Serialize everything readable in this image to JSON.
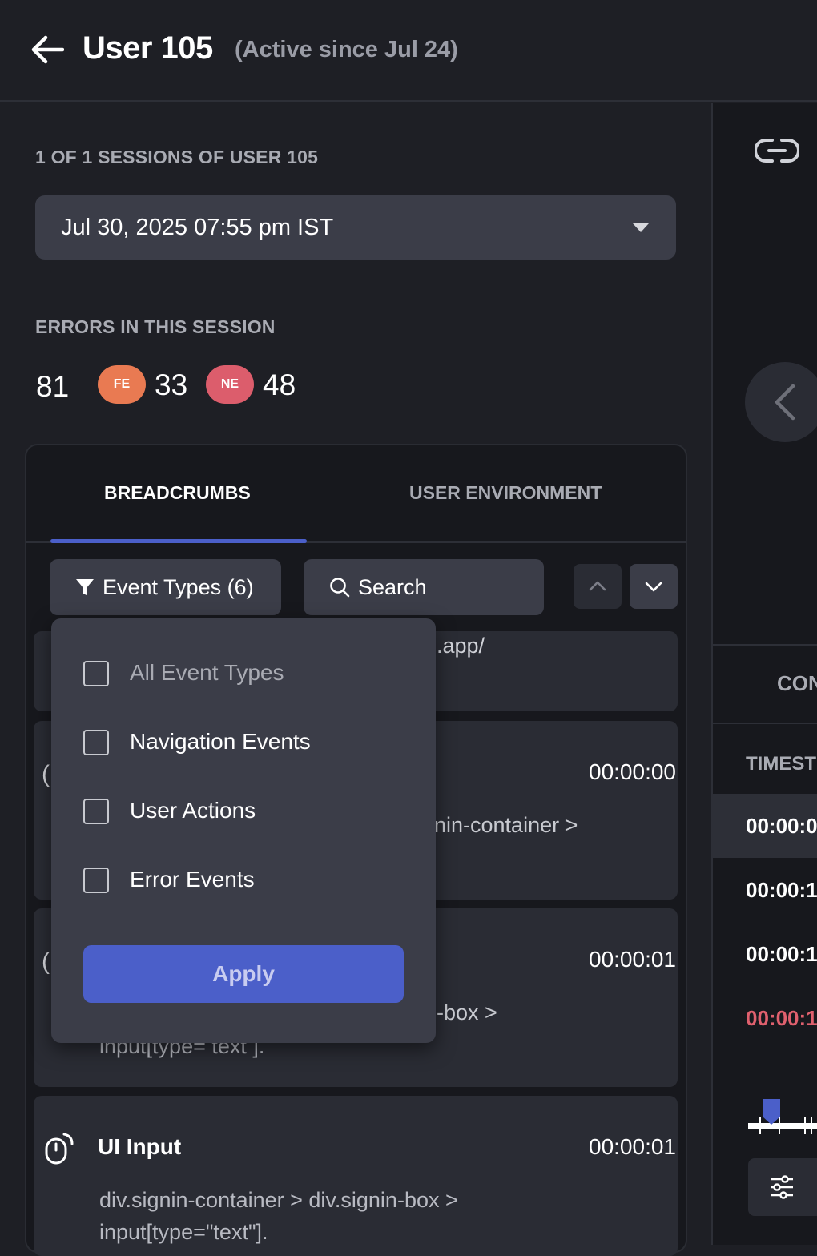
{
  "header": {
    "title": "User 105",
    "subtitle": "(Active since Jul 24)"
  },
  "sessions": {
    "label": "1 OF 1 SESSIONS OF USER 105",
    "selected": "Jul 30, 2025 07:55 pm IST"
  },
  "errors": {
    "label": "ERRORS IN THIS SESSION",
    "total": "81",
    "fe_badge": "FE",
    "fe_count": "33",
    "ne_badge": "NE",
    "ne_count": "48",
    "colors": {
      "fe": "#e97a52",
      "ne": "#dc5d6c"
    }
  },
  "tabs": [
    {
      "label": "BREADCRUMBS",
      "active": true
    },
    {
      "label": "USER ENVIRONMENT",
      "active": false
    }
  ],
  "toolbar": {
    "filter_label": "Event Types (6)",
    "search_label": "Search"
  },
  "events": [
    {
      "desc_partial": ".app/"
    },
    {
      "icon_partial": "(",
      "time": "00:00:00",
      "desc_partial": "nin-container >"
    },
    {
      "icon_partial": "(",
      "time": "00:00:01",
      "desc_partial_1": "-box >",
      "desc_partial_2": "input[type= text ]."
    },
    {
      "title": "UI Input",
      "time": "00:00:01",
      "desc_line1": "div.signin-container > div.signin-box >",
      "desc_line2": "input[type=\"text\"]."
    }
  ],
  "dropdown": {
    "options": [
      {
        "label": "All Event Types",
        "checked": false
      },
      {
        "label": "Navigation Events",
        "checked": false
      },
      {
        "label": "User Actions",
        "checked": false
      },
      {
        "label": "Error Events",
        "checked": false
      }
    ],
    "apply_label": "Apply"
  },
  "right_panel": {
    "tab_partial": "CON",
    "column_head": "TIMEST",
    "times": [
      {
        "text": "00:00:0",
        "color": "#ffffff"
      },
      {
        "text": "00:00:1",
        "color": "#ffffff"
      },
      {
        "text": "00:00:1",
        "color": "#ffffff"
      },
      {
        "text": "00:00:1",
        "color": "#e0606e"
      }
    ]
  },
  "accent": "#4b5fc9"
}
